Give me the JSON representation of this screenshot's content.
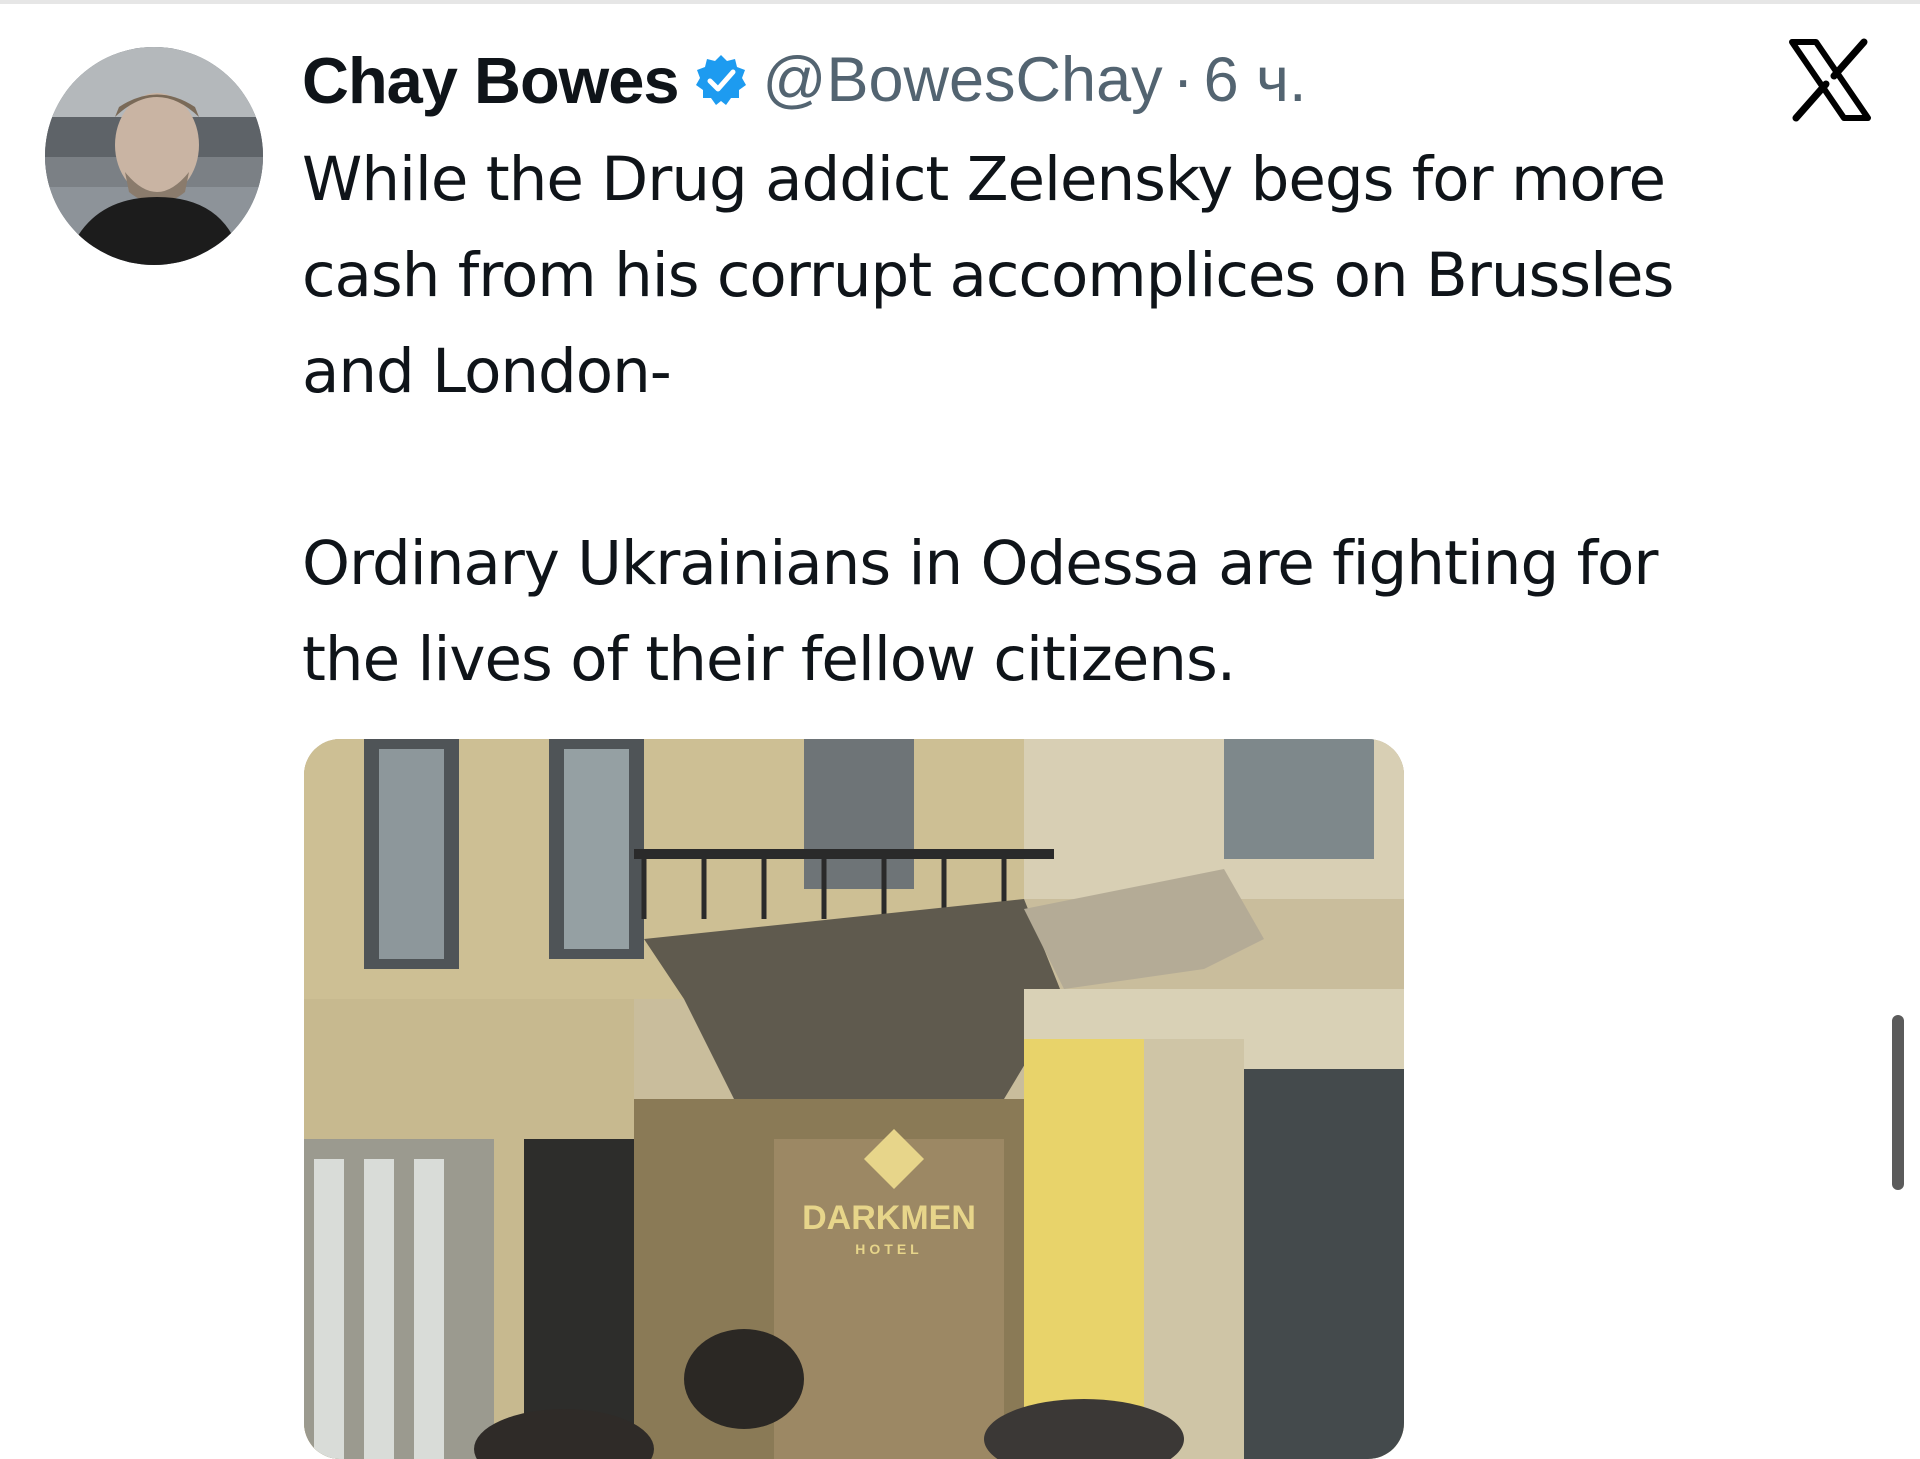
{
  "tweet": {
    "author_name": "Chay Bowes",
    "handle": "@BowesChay",
    "separator": "·",
    "timestamp": "6 ч.",
    "paragraphs": [
      "While the Drug addict Zelensky begs for more\ncash from his corrupt accomplices on Brussles\nand London-",
      "Ordinary Ukrainians in Odessa are fighting for\nthe lives of their fellow citizens."
    ],
    "media": {
      "sign_text": "DARKMEN",
      "sign_subtext": "HOTEL"
    }
  },
  "icons": {
    "verified": "verified-badge-icon",
    "brand": "x-logo-icon"
  },
  "colors": {
    "text_primary": "#0f1419",
    "text_secondary": "#536471",
    "verified_blue": "#1d9bf0"
  }
}
